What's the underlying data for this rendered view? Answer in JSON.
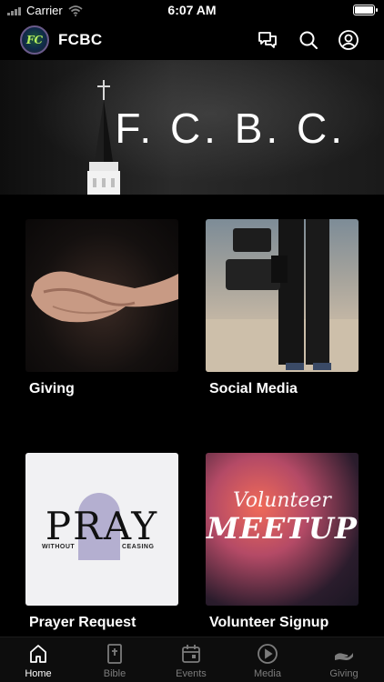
{
  "status_bar": {
    "carrier": "Carrier",
    "time": "6:07 AM"
  },
  "header": {
    "logo_text": "FC",
    "title": "FCBC"
  },
  "banner": {
    "title": "F. C. B. C."
  },
  "cards": [
    {
      "label": "Giving"
    },
    {
      "label": "Social Media"
    },
    {
      "label": "Prayer Request",
      "image_text": {
        "main": "PRAY",
        "sub_left": "WITHOUT",
        "sub_right": "CEASING"
      }
    },
    {
      "label": "Volunteer Signup",
      "image_text": {
        "script": "Volunteer",
        "main": "MEETUP"
      }
    }
  ],
  "tabs": [
    {
      "label": "Home",
      "icon": "home-icon",
      "active": true
    },
    {
      "label": "Bible",
      "icon": "bible-icon",
      "active": false
    },
    {
      "label": "Events",
      "icon": "calendar-icon",
      "active": false
    },
    {
      "label": "Media",
      "icon": "play-icon",
      "active": false
    },
    {
      "label": "Giving",
      "icon": "giving-hand-icon",
      "active": false
    }
  ],
  "colors": {
    "background": "#000000",
    "tab_active": "#ffffff",
    "tab_inactive": "#7c7c7c"
  }
}
